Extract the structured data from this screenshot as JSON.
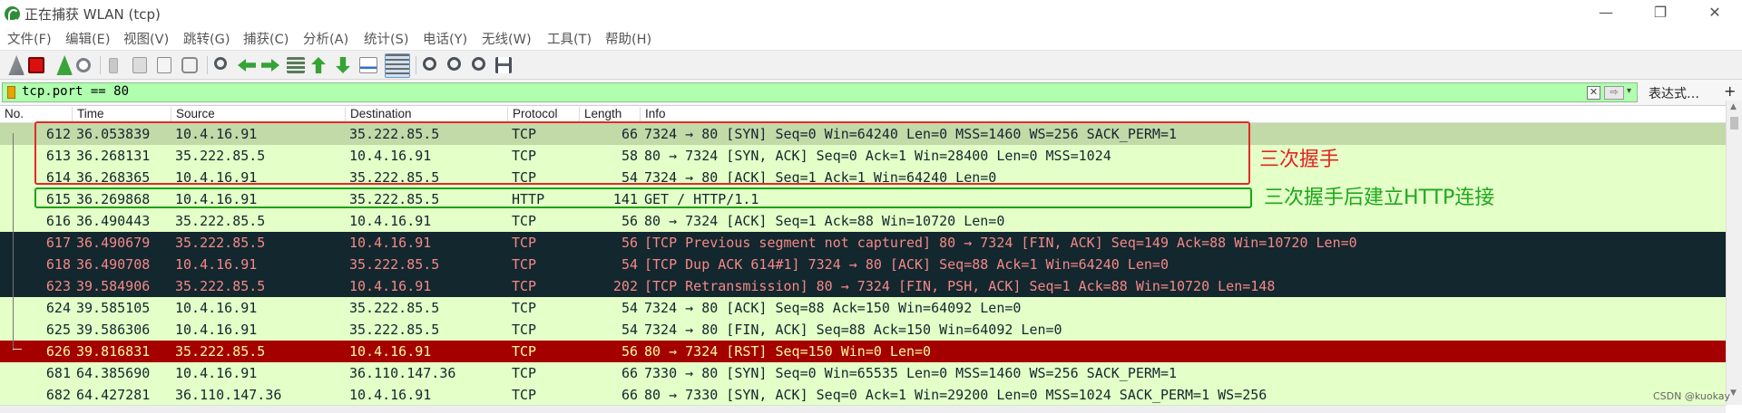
{
  "window": {
    "title": "正在捕获 WLAN (tcp)",
    "minimize_glyph": "—",
    "maximize_glyph": "❐",
    "close_glyph": "✕"
  },
  "menu": [
    "文件(F)",
    "编辑(E)",
    "视图(V)",
    "跳转(G)",
    "捕获(C)",
    "分析(A)",
    "统计(S)",
    "电话(Y)",
    "无线(W)",
    "工具(T)",
    "帮助(H)"
  ],
  "toolbar_icons": [
    "shark-fin-start-icon",
    "stop-capture-icon",
    "restart-capture-icon",
    "capture-options-icon",
    "open-file-icon",
    "save-file-icon",
    "close-file-icon",
    "reload-file-icon",
    "find-packet-icon",
    "go-back-icon",
    "go-forward-icon",
    "go-to-packet-icon",
    "go-first-icon",
    "go-last-icon",
    "autoscroll-icon",
    "colorize-icon",
    "zoom-in-icon",
    "zoom-out-icon",
    "zoom-normal-icon",
    "resize-columns-icon"
  ],
  "filter": {
    "value": "tcp.port == 80",
    "bg_color": "#afffaf",
    "clear_glyph": "✕",
    "apply_glyph": "⇨",
    "dropdown_glyph": "▾",
    "expression_label": "表达式…",
    "add_label": "+"
  },
  "packet_list": {
    "columns": [
      "No.",
      "Time",
      "Source",
      "Destination",
      "Protocol",
      "Length",
      "Info"
    ],
    "rows": [
      {
        "no": "612",
        "time": "36.053839",
        "src": "10.4.16.91",
        "dst": "35.222.85.5",
        "proto": "TCP",
        "len": "66",
        "info": "7324 → 80 [SYN] Seq=0 Win=64240 Len=0 MSS=1460 WS=256 SACK_PERM=1",
        "style": "sel"
      },
      {
        "no": "613",
        "time": "36.268131",
        "src": "35.222.85.5",
        "dst": "10.4.16.91",
        "proto": "TCP",
        "len": "58",
        "info": "80 → 7324 [SYN, ACK] Seq=0 Ack=1 Win=28400 Len=0 MSS=1024",
        "style": "green"
      },
      {
        "no": "614",
        "time": "36.268365",
        "src": "10.4.16.91",
        "dst": "35.222.85.5",
        "proto": "TCP",
        "len": "54",
        "info": "7324 → 80 [ACK] Seq=1 Ack=1 Win=64240 Len=0",
        "style": "green"
      },
      {
        "no": "615",
        "time": "36.269868",
        "src": "10.4.16.91",
        "dst": "35.222.85.5",
        "proto": "HTTP",
        "len": "141",
        "info": "GET / HTTP/1.1",
        "style": "green"
      },
      {
        "no": "616",
        "time": "36.490443",
        "src": "35.222.85.5",
        "dst": "10.4.16.91",
        "proto": "TCP",
        "len": "56",
        "info": "80 → 7324 [ACK] Seq=1 Ack=88 Win=10720 Len=0",
        "style": "green"
      },
      {
        "no": "617",
        "time": "36.490679",
        "src": "35.222.85.5",
        "dst": "10.4.16.91",
        "proto": "TCP",
        "len": "56",
        "info": "[TCP Previous segment not captured] 80 → 7324 [FIN, ACK] Seq=149 Ack=88 Win=10720 Len=0",
        "style": "dark"
      },
      {
        "no": "618",
        "time": "36.490708",
        "src": "10.4.16.91",
        "dst": "35.222.85.5",
        "proto": "TCP",
        "len": "54",
        "info": "[TCP Dup ACK 614#1] 7324 → 80 [ACK] Seq=88 Ack=1 Win=64240 Len=0",
        "style": "dark"
      },
      {
        "no": "623",
        "time": "39.584906",
        "src": "35.222.85.5",
        "dst": "10.4.16.91",
        "proto": "TCP",
        "len": "202",
        "info": "[TCP Retransmission] 80 → 7324 [FIN, PSH, ACK] Seq=1 Ack=88 Win=10720 Len=148",
        "style": "dark"
      },
      {
        "no": "624",
        "time": "39.585105",
        "src": "10.4.16.91",
        "dst": "35.222.85.5",
        "proto": "TCP",
        "len": "54",
        "info": "7324 → 80 [ACK] Seq=88 Ack=150 Win=64092 Len=0",
        "style": "green"
      },
      {
        "no": "625",
        "time": "39.586306",
        "src": "10.4.16.91",
        "dst": "35.222.85.5",
        "proto": "TCP",
        "len": "54",
        "info": "7324 → 80 [FIN, ACK] Seq=88 Ack=150 Win=64092 Len=0",
        "style": "green"
      },
      {
        "no": "626",
        "time": "39.816831",
        "src": "35.222.85.5",
        "dst": "10.4.16.91",
        "proto": "TCP",
        "len": "56",
        "info": "80 → 7324 [RST] Seq=150 Win=0 Len=0",
        "style": "red"
      },
      {
        "no": "681",
        "time": "64.385690",
        "src": "10.4.16.91",
        "dst": "36.110.147.36",
        "proto": "TCP",
        "len": "66",
        "info": "7330 → 80 [SYN] Seq=0 Win=65535 Len=0 MSS=1460 WS=256 SACK_PERM=1",
        "style": "green"
      },
      {
        "no": "682",
        "time": "64.427281",
        "src": "36.110.147.36",
        "dst": "10.4.16.91",
        "proto": "TCP",
        "len": "66",
        "info": "80 → 7330 [SYN, ACK] Seq=0 Ack=1 Win=29200 Len=0 MSS=1024 SACK_PERM=1 WS=256",
        "style": "green"
      }
    ]
  },
  "annotations": {
    "handshake_label": "三次握手",
    "http_label": "三次握手后建立HTTP连接",
    "handshake_color": "#e02a2a",
    "http_color": "#19a319"
  },
  "watermark": "CSDN @kuokay"
}
